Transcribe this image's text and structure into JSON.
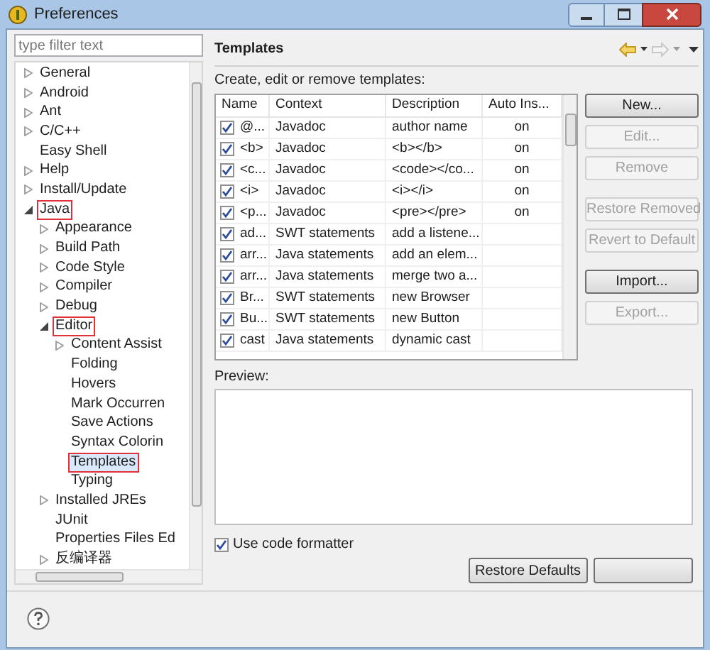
{
  "window": {
    "title": "Preferences"
  },
  "filter": {
    "placeholder": "type filter text"
  },
  "tree": [
    {
      "kind": "group",
      "label": "General",
      "expanded": false,
      "selected": false,
      "marked": false
    },
    {
      "kind": "group",
      "label": "Android",
      "expanded": false,
      "selected": false,
      "marked": false
    },
    {
      "kind": "group",
      "label": "Ant",
      "expanded": false,
      "selected": false,
      "marked": false
    },
    {
      "kind": "group",
      "label": "C/C++",
      "expanded": false,
      "selected": false,
      "marked": false
    },
    {
      "kind": "page",
      "label": "Easy Shell",
      "selected": false,
      "marked": false
    },
    {
      "kind": "group",
      "label": "Help",
      "expanded": false,
      "selected": false,
      "marked": false
    },
    {
      "kind": "group",
      "label": "Install/Update",
      "expanded": false,
      "selected": false,
      "marked": false
    },
    {
      "kind": "group",
      "label": "Java",
      "expanded": true,
      "selected": false,
      "marked": true,
      "children": [
        {
          "kind": "group",
          "label": "Appearance",
          "expanded": false,
          "selected": false,
          "marked": false
        },
        {
          "kind": "group",
          "label": "Build Path",
          "expanded": false,
          "selected": false,
          "marked": false
        },
        {
          "kind": "group",
          "label": "Code Style",
          "expanded": false,
          "selected": false,
          "marked": false
        },
        {
          "kind": "group",
          "label": "Compiler",
          "expanded": false,
          "selected": false,
          "marked": false
        },
        {
          "kind": "group",
          "label": "Debug",
          "expanded": false,
          "selected": false,
          "marked": false
        },
        {
          "kind": "group",
          "label": "Editor",
          "expanded": true,
          "selected": false,
          "marked": true,
          "children": [
            {
              "kind": "group",
              "label": "Content Assist",
              "expanded": false,
              "selected": false,
              "marked": false
            },
            {
              "kind": "page",
              "label": "Folding",
              "selected": false,
              "marked": false
            },
            {
              "kind": "page",
              "label": "Hovers",
              "selected": false,
              "marked": false
            },
            {
              "kind": "page",
              "label": "Mark Occurren",
              "selected": false,
              "marked": false
            },
            {
              "kind": "page",
              "label": "Save Actions",
              "selected": false,
              "marked": false
            },
            {
              "kind": "page",
              "label": "Syntax Colorin",
              "selected": false,
              "marked": false
            },
            {
              "kind": "page",
              "label": "Templates",
              "selected": true,
              "marked": true
            },
            {
              "kind": "page",
              "label": "Typing",
              "selected": false,
              "marked": false
            }
          ]
        },
        {
          "kind": "group",
          "label": "Installed JREs",
          "expanded": false,
          "selected": false,
          "marked": false
        },
        {
          "kind": "page",
          "label": "JUnit",
          "selected": false,
          "marked": false
        },
        {
          "kind": "page",
          "label": "Properties Files Ed",
          "selected": false,
          "marked": false
        },
        {
          "kind": "group",
          "label": "反编译器",
          "expanded": false,
          "selected": false,
          "marked": false
        }
      ]
    }
  ],
  "page": {
    "title": "Templates",
    "description": "Create, edit or remove templates:"
  },
  "table": {
    "columns": [
      "Name",
      "Context",
      "Description",
      "Auto Ins..."
    ],
    "rows": [
      {
        "checked": true,
        "cells": [
          "@...",
          "Javadoc",
          "author name",
          "on"
        ]
      },
      {
        "checked": true,
        "cells": [
          "<b>",
          "Javadoc",
          "<b></b>",
          "on"
        ]
      },
      {
        "checked": true,
        "cells": [
          "<c...",
          "Javadoc",
          "<code></co...",
          "on"
        ]
      },
      {
        "checked": true,
        "cells": [
          "<i>",
          "Javadoc",
          "<i></i>",
          "on"
        ]
      },
      {
        "checked": true,
        "cells": [
          "<p...",
          "Javadoc",
          "<pre></pre>",
          "on"
        ]
      },
      {
        "checked": true,
        "cells": [
          "ad...",
          "SWT statements",
          "add a listene..."
        ]
      },
      {
        "checked": true,
        "cells": [
          "arr...",
          "Java statements",
          "add an elem..."
        ]
      },
      {
        "checked": true,
        "cells": [
          "arr...",
          "Java statements",
          "merge two a..."
        ]
      },
      {
        "checked": true,
        "cells": [
          "Br...",
          "SWT statements",
          "new Browser"
        ]
      },
      {
        "checked": true,
        "cells": [
          "Bu...",
          "SWT statements",
          "new Button"
        ]
      },
      {
        "checked": true,
        "cells": [
          "cast",
          "Java statements",
          "dynamic cast"
        ]
      }
    ]
  },
  "button_groups": [
    [
      {
        "label": "New...",
        "disabled": false
      },
      {
        "label": "Edit...",
        "disabled": true
      },
      {
        "label": "Remove",
        "disabled": true
      }
    ],
    [
      {
        "label": "Restore Removed",
        "disabled": true
      },
      {
        "label": "Revert to Default",
        "disabled": true
      }
    ],
    [
      {
        "label": "Import...",
        "disabled": false
      },
      {
        "label": "Export...",
        "disabled": true
      }
    ]
  ],
  "preview": {
    "label": "Preview:"
  },
  "formatter": {
    "label": "Use code formatter",
    "checked": true
  },
  "footer_buttons": [
    "Restore Defaults"
  ]
}
